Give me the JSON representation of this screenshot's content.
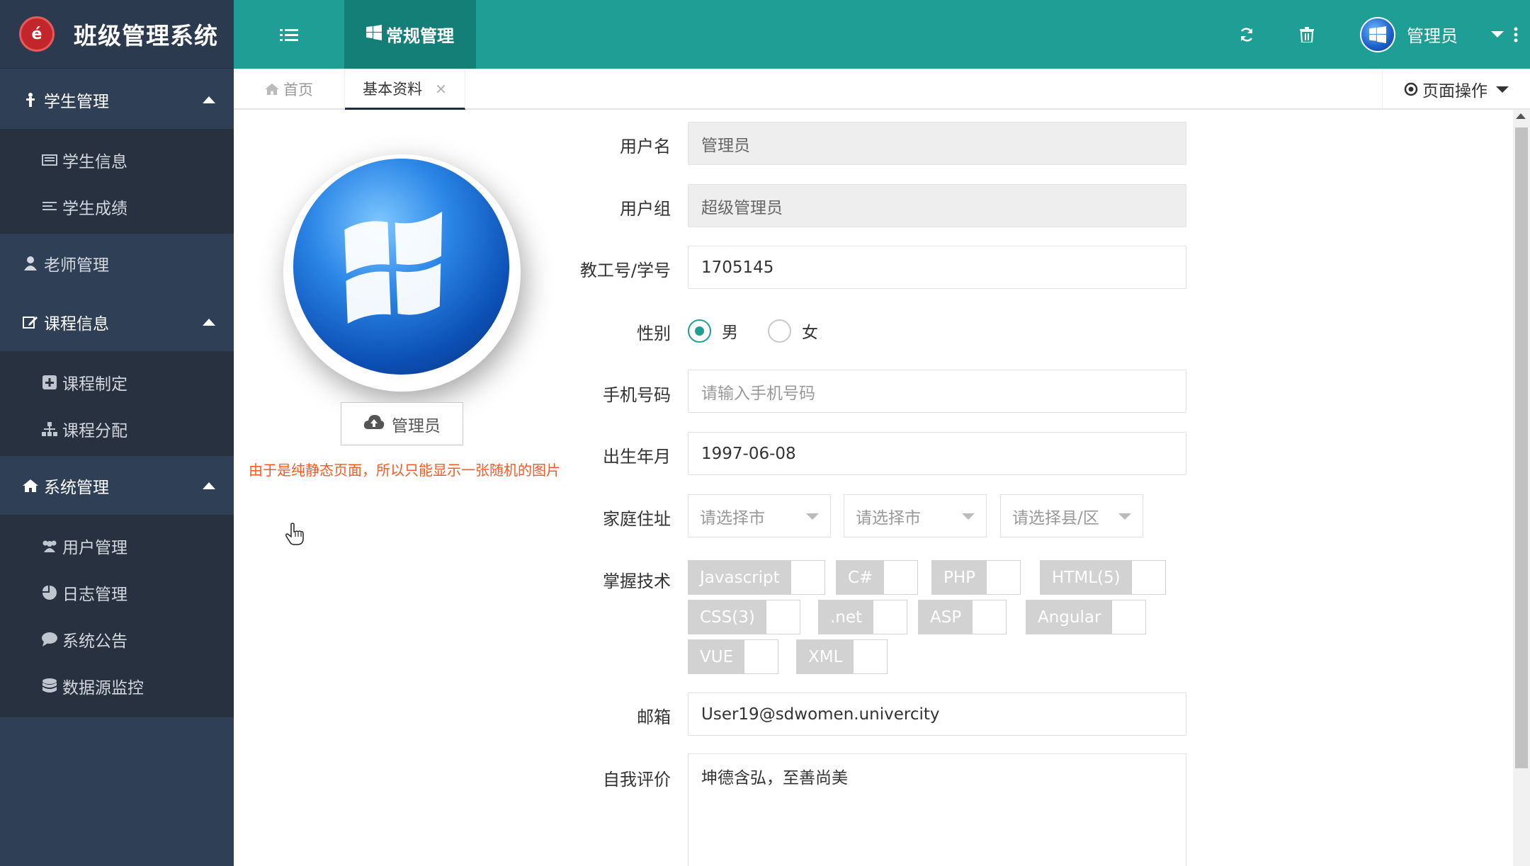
{
  "app": {
    "title": "班级管理系统"
  },
  "sidebar": {
    "groups": [
      {
        "label": "学生管理",
        "items": [
          {
            "label": "学生信息"
          },
          {
            "label": "学生成绩"
          }
        ]
      },
      {
        "label": "老师管理",
        "items": []
      },
      {
        "label": "课程信息",
        "items": [
          {
            "label": "课程制定"
          },
          {
            "label": "课程分配"
          }
        ]
      },
      {
        "label": "系统管理",
        "items": [
          {
            "label": "用户管理"
          },
          {
            "label": "日志管理"
          },
          {
            "label": "系统公告"
          },
          {
            "label": "数据源监控"
          }
        ]
      }
    ]
  },
  "topbar": {
    "active_tab": "常规管理",
    "user": "管理员"
  },
  "tabs": {
    "home": "首页",
    "profile": "基本资料",
    "page_ops": "页面操作"
  },
  "profile": {
    "avatar_button": "管理员",
    "note": "由于是纯静态页面，所以只能显示一张随机的图片"
  },
  "form": {
    "username": {
      "label": "用户名",
      "value": "管理员"
    },
    "group": {
      "label": "用户组",
      "value": "超级管理员"
    },
    "id_no": {
      "label": "教工号/学号",
      "value": "1705145"
    },
    "gender": {
      "label": "性别",
      "male": "男",
      "female": "女",
      "selected": "男"
    },
    "phone": {
      "label": "手机号码",
      "placeholder": "请输入手机号码"
    },
    "birth": {
      "label": "出生年月",
      "value": "1997-06-08"
    },
    "address": {
      "label": "家庭住址",
      "province": "请选择市",
      "city": "请选择市",
      "district": "请选择县/区"
    },
    "skills": {
      "label": "掌握技术",
      "items": [
        "Javascript",
        "C#",
        "PHP",
        "HTML(5)",
        "CSS(3)",
        ".net",
        "ASP",
        "Angular",
        "VUE",
        "XML"
      ]
    },
    "email": {
      "label": "邮箱",
      "value": "User19@sdwomen.univercity"
    },
    "self_eval": {
      "label": "自我评价",
      "value": "坤德含弘，至善尚美"
    }
  },
  "colors": {
    "topbar": "#1e9e94",
    "sidebar": "#2f4056",
    "accent_orange": "#ff5722"
  },
  "icons": {
    "menu_toggle": "list-icon",
    "refresh": "refresh-icon",
    "trash": "trash-icon",
    "more": "more-vertical-icon",
    "home": "home-icon",
    "upload": "cloud-upload-icon"
  }
}
